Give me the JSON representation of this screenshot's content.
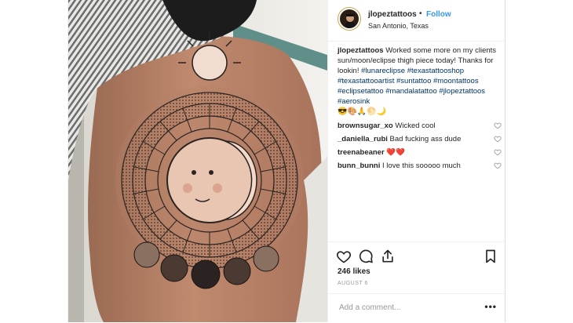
{
  "post": {
    "username": "jlopeztattoos",
    "separator": "•",
    "follow_label": "Follow",
    "location": "San Antonio, Texas",
    "caption": {
      "username": "jlopeztattoos",
      "text": "Worked some more on my clients sun/moon/eclipse thigh piece today! Thanks for lookin!",
      "hashtags": [
        "#lunareclipse",
        "#texastattooshop",
        "#texastattooartist",
        "#suntattoo",
        "#moontattoos",
        "#eclipsetattoo",
        "#mandalatattoo",
        "#jlopeztattoos",
        "#aerosink"
      ],
      "emojis": "😎🎨🙏🌕🌙"
    },
    "comments": [
      {
        "username": "brownsugar_xo",
        "text": "Wicked cool"
      },
      {
        "username": "_daniella_rubi",
        "text": "Bad fucking ass dude"
      },
      {
        "username": "treenabeaner",
        "text": "❤️❤️"
      },
      {
        "username": "bunn_bunni",
        "text": "I love this sooooo much"
      }
    ],
    "likes": "246 likes",
    "date": "AUGUST 6",
    "add_comment_placeholder": "Add a comment...",
    "more_label": "•••"
  },
  "colors": {
    "link_blue": "#3897f0",
    "hashtag": "#003569",
    "text": "#262626",
    "muted": "#999999"
  }
}
